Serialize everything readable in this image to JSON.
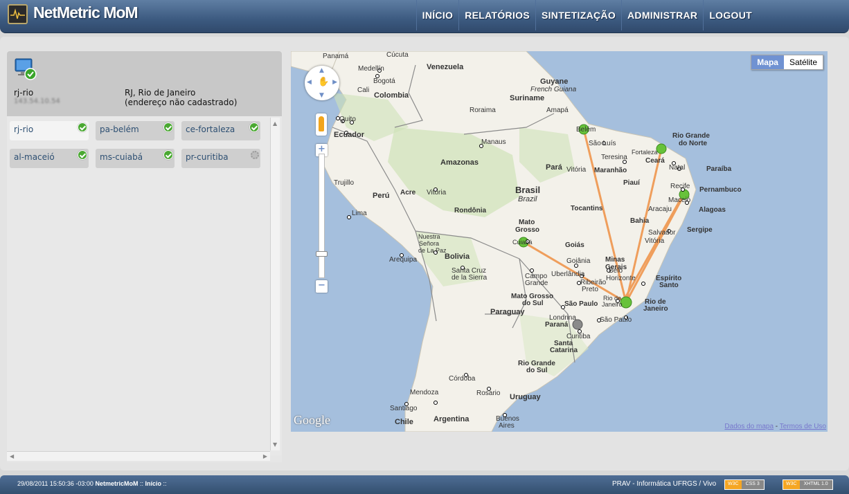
{
  "app": {
    "title": "NetMetric MoM"
  },
  "nav": [
    "INÍCIO",
    "RELATÓRIOS",
    "SINTETIZAÇÃO",
    "ADMINISTRAR",
    "LOGOUT"
  ],
  "device": {
    "name": "rj-rio",
    "ip": "143.54.10.54",
    "location": "RJ, Rio de Janeiro",
    "address": "(endereço não cadastrado)"
  },
  "agents": [
    {
      "label": "rj-rio",
      "status": "ok"
    },
    {
      "label": "pa-belém",
      "status": "ok"
    },
    {
      "label": "ce-fortaleza",
      "status": "ok"
    },
    {
      "label": "al-maceió",
      "status": "ok"
    },
    {
      "label": "ms-cuiabá",
      "status": "ok"
    },
    {
      "label": "pr-curitiba",
      "status": "pending"
    }
  ],
  "map": {
    "type_buttons": [
      "Mapa",
      "Satélite"
    ],
    "active_type": "Mapa",
    "google_logo": "Google",
    "attribution_link": "Dados do mapa",
    "attribution_sep": " - ",
    "terms_link": "Termos de Uso",
    "labels": {
      "panama": "Panamá",
      "cucuta": "Cúcuta",
      "venezuela": "Venezuela",
      "medellin": "Medellín",
      "bogota": "Bogotá",
      "cali": "Cali",
      "colombia": "Colombia",
      "guyane": "Guyane",
      "frenchguiana": "French Guiana",
      "suriname": "Suriname",
      "roraima": "Roraima",
      "amapa": "Amapá",
      "quito": "Quito",
      "ecuador": "Ecuador",
      "manaus": "Manaus",
      "belem": "Belém",
      "saoluis": "São Luís",
      "fortaleza": "Fortaleza",
      "ceara": "Ceará",
      "rgn": "Rio Grande",
      "rgn2": "do Norte",
      "natal": "Natal",
      "paraiba": "Paraíba",
      "teresina": "Teresina",
      "amazonas": "Amazonas",
      "para": "Pará",
      "vitoria_mr": "Vitória",
      "maranhao": "Maranhão",
      "piaui": "Piauí",
      "recife": "Recife",
      "pernambuco": "Pernambuco",
      "trujillo": "Trujillo",
      "peru": "Perú",
      "acre": "Acre",
      "vitoria_ac": "Vitória",
      "brasil": "Brasil",
      "brazil": "Brazil",
      "maceio": "Maceió",
      "alagoas": "Alagoas",
      "aracaju": "Aracaju",
      "sergipe": "Sergipe",
      "lima": "Lima",
      "rondonia": "Rondônia",
      "tocantins": "Tocantins",
      "bahia": "Bahia",
      "salvador": "Salvador",
      "vitoria_ba": "Vitória",
      "matogrosso": "Mato",
      "matogrosso2": "Grosso",
      "cuiaba": "Cuiabá",
      "goias": "Goiás",
      "goiania": "Goiânia",
      "minas": "Minas",
      "gerais": "Gerais",
      "belo": "Belo",
      "horizonte": "Horizonte",
      "nuestra": "Nuestra",
      "senora": "Señora",
      "delapaz": "de La Paz",
      "bolivia": "Bolivia",
      "arequipa": "Arequipa",
      "santacruz": "Santa Cruz",
      "santacruz2": "de la Sierra",
      "campo": "Campo",
      "grande": "Grande",
      "uberlandia": "Uberlândia",
      "ribeirao": "Ribeirão",
      "preto": "Preto",
      "es": "Espírito",
      "es2": "Santo",
      "mgsul": "Mato Grosso",
      "mgsul2": "do Sul",
      "saopaulo_st": "São Paulo",
      "riodejaneiro_c": "Rio de",
      "riodejaneiro_c2": "Janeiro",
      "rj_st": "Rio de",
      "rj_st2": "Janeiro",
      "paraguay": "Paraguay",
      "londrina": "Londrina",
      "parana": "Paraná",
      "saopaulo_c": "São Paulo",
      "curitiba": "Curitiba",
      "sc": "Santa",
      "sc2": "Catarina",
      "rgs": "Rio Grande",
      "rgs2": "do Sul",
      "cordoba": "Córdoba",
      "mendoza": "Mendoza",
      "rosario": "Rosario",
      "uruguay": "Uruguay",
      "santiago": "Santiago",
      "chile": "Chile",
      "argentina": "Argentina",
      "buenosaires": "Buenos",
      "buenosaires2": "Aires"
    }
  },
  "footer": {
    "datetime": "29/08/2011 15:50:36 -03:00",
    "app": "NetmetricMoM",
    "sep": "::",
    "page": "Início",
    "end": "::",
    "credit": "PRAV - Informática UFRGS / Vivo",
    "badge1_l": "W3C",
    "badge1_r": "CSS 3",
    "badge2_l": "W3C",
    "badge2_r": "XHTML 1.0"
  }
}
